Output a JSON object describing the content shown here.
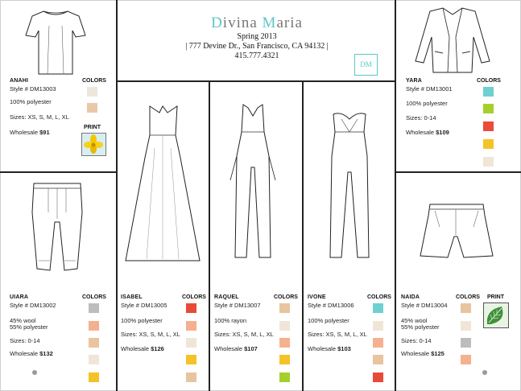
{
  "header": {
    "brand_first": "D",
    "brand_mid": "ivina ",
    "brand_second": "M",
    "brand_last": "aria",
    "season": "Spring 2013",
    "address": "| 777 Devine Dr., San Francisco, CA 94132 |",
    "phone": "415.777.4321",
    "logo": "DM",
    "accent_color": "#5bc8c8"
  },
  "labels": {
    "colors": "COLORS",
    "print": "PRINT",
    "wholesale": "Wholesale"
  },
  "products": {
    "anahi": {
      "name": "ANAHI",
      "style": "Style # DM13003",
      "material": "100% polyester",
      "sizes": "Sizes: XS, S, M, L, XL",
      "price": "$91",
      "colors": [
        "#ece6dc",
        "#e9c8a7"
      ],
      "print_icon": "yellow-flower-icon"
    },
    "yara": {
      "name": "YARA",
      "style": "Style # DM13001",
      "material": "100% polyester",
      "sizes": "Sizes: 0-14",
      "price": "$109",
      "colors": [
        "#6fd1cf",
        "#a7cf2c",
        "#ea4b3a",
        "#f4c328",
        "#efe6d7"
      ]
    },
    "uiara": {
      "name": "UIARA",
      "style": "Style # DM13002",
      "material_1": "45% wool",
      "material_2": "55% polyester",
      "sizes": "Sizes: 0-14",
      "price": "$132",
      "colors": [
        "#bdbdbd",
        "#f5b08f",
        "#e8c49f",
        "#efe6d7",
        "#f4c328"
      ]
    },
    "isabel": {
      "name": "ISABEL",
      "style": "Style # DM13005",
      "material": "100% polyester",
      "sizes": "Sizes: XS, S, M, L, XL",
      "price": "$126",
      "colors": [
        "#e84a38",
        "#f5b08f",
        "#efe6d7",
        "#f4c328",
        "#e8c49f"
      ]
    },
    "raquel": {
      "name": "RAQUEL",
      "style": "Style # DM13007",
      "material": "100% rayon",
      "sizes": "Sizes: XS, S, M, L, XL",
      "price": "$107",
      "colors": [
        "#e8c49f",
        "#efe6d7",
        "#f5b08f",
        "#f4c328",
        "#a7cf2c"
      ]
    },
    "ivone": {
      "name": "IVONE",
      "style": "Style # DM13006",
      "material": "100% polyester",
      "sizes": "Sizes: XS, S, M, L, XL",
      "price": "$103",
      "colors": [
        "#6fd1cf",
        "#efe6d7",
        "#f5b08f",
        "#e8c49f",
        "#e84a38"
      ]
    },
    "naida": {
      "name": "NAIDA",
      "style": "Style # DM13004",
      "material_1": "45% wool",
      "material_2": "55% polyester",
      "sizes": "Sizes: 0-14",
      "price": "$125",
      "colors": [
        "#e8c49f",
        "#efe6d7",
        "#bdbdbd",
        "#f5b08f"
      ],
      "print_icon": "leaf-print-icon"
    }
  }
}
